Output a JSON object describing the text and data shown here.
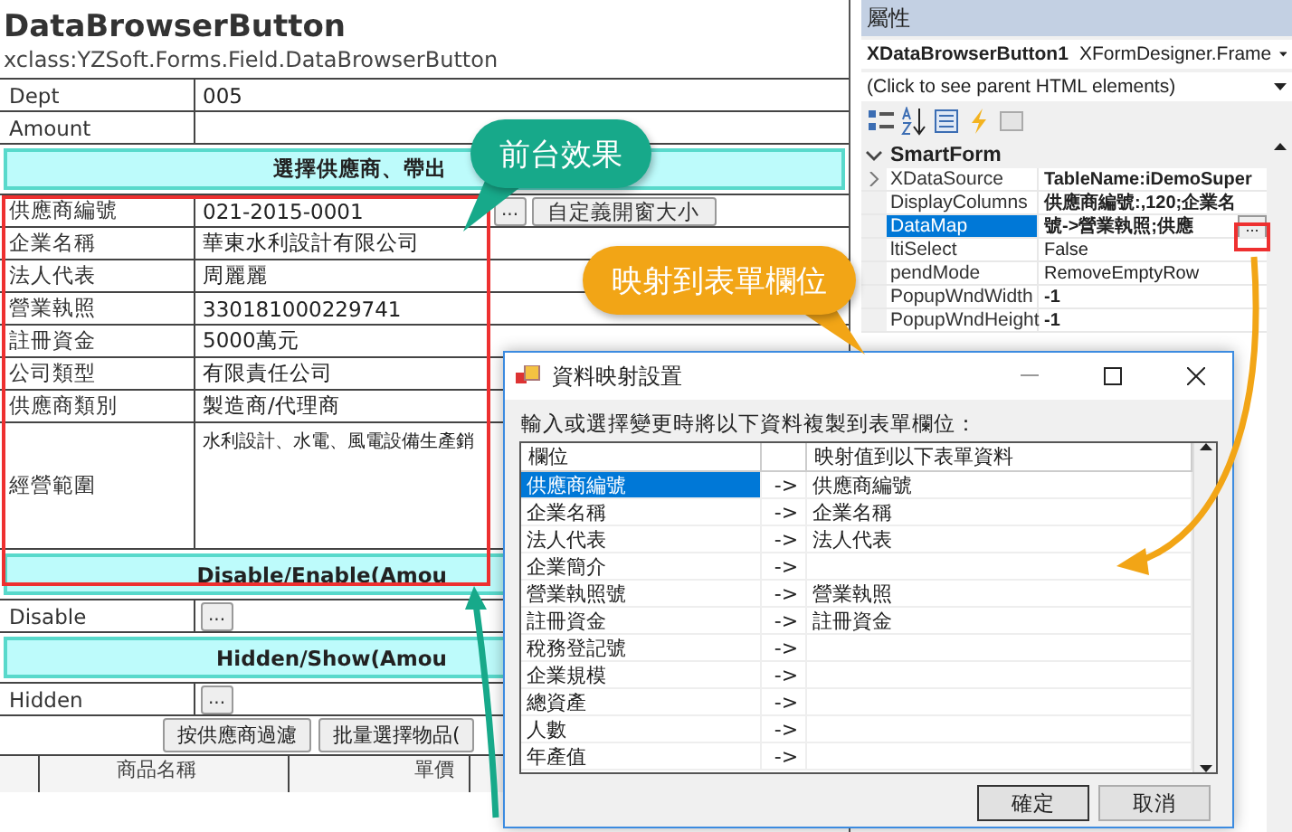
{
  "form": {
    "title": "DataBrowserButton",
    "subtitle": "xclass:YZSoft.Forms.Field.DataBrowserButton",
    "rows": [
      {
        "kind": "field",
        "label": "Dept",
        "value": "005"
      },
      {
        "kind": "field",
        "label": "Amount"
      },
      {
        "kind": "band",
        "text": "選擇供應商、帶出"
      },
      {
        "kind": "field",
        "label": "供應商編號",
        "value": "021-2015-0001",
        "buttons": [
          "...",
          "自定義開窗大小"
        ]
      },
      {
        "kind": "field",
        "label": "企業名稱",
        "value": "華東水利設計有限公司"
      },
      {
        "kind": "field",
        "label": "法人代表",
        "value": "周麗麗"
      },
      {
        "kind": "field",
        "label": "營業執照",
        "value": "330181000229741"
      },
      {
        "kind": "field",
        "label": "註冊資金",
        "value": "5000萬元"
      },
      {
        "kind": "field",
        "label": "公司類型",
        "value": "有限責任公司"
      },
      {
        "kind": "field",
        "label": "供應商類別",
        "value": "製造商/代理商"
      },
      {
        "kind": "area",
        "label": "經營範圍",
        "value": "水利設計、水電、風電設備生產銷"
      },
      {
        "kind": "band",
        "text": "Disable/Enable(Amou"
      },
      {
        "kind": "field",
        "label": "Disable",
        "buttons": [
          "..."
        ]
      },
      {
        "kind": "band",
        "text": "Hidden/Show(Amou"
      },
      {
        "kind": "field",
        "label": "Hidden",
        "buttons": [
          "..."
        ]
      },
      {
        "kind": "actions",
        "buttons": [
          "按供應商過濾",
          "批量選擇物品("
        ]
      },
      {
        "kind": "table_header",
        "columns": [
          "商品名稱",
          "單價"
        ]
      }
    ]
  },
  "properties": {
    "title": "屬性",
    "object": {
      "name": "XDataBrowserButton1",
      "type": "XFormDesigner.Frame"
    },
    "parent_hint": "(Click to see parent HTML elements)",
    "category": {
      "name": "SmartForm",
      "expanded": true
    },
    "rows": [
      {
        "name": "XDataSource",
        "value": "TableName:iDemoSuper",
        "expandable": true,
        "modified": true,
        "selected": false
      },
      {
        "name": "DisplayColumns",
        "value": "供應商編號:,120;企業名",
        "expandable": false,
        "modified": true,
        "selected": false
      },
      {
        "name": "DataMap",
        "value": "號->營業執照;供應",
        "expandable": false,
        "modified": true,
        "selected": true,
        "button": "..."
      },
      {
        "name": "ltiSelect",
        "value": "False",
        "expandable": false,
        "modified": false,
        "selected": false
      },
      {
        "name": "pendMode",
        "value": "RemoveEmptyRow",
        "expandable": false,
        "modified": false,
        "selected": false
      },
      {
        "name": "PopupWndWidth",
        "value": "-1",
        "expandable": false,
        "modified": true,
        "selected": false
      },
      {
        "name": "PopupWndHeight",
        "value": "-1",
        "expandable": false,
        "modified": true,
        "selected": false
      }
    ]
  },
  "dialog": {
    "title": "資料映射設置",
    "prompt": "輸入或選擇變更時將以下資料複製到表單欄位：",
    "columns": [
      "欄位",
      "映射值到以下表單資料"
    ],
    "rows": [
      {
        "field": "供應商編號",
        "arrow": "->",
        "target": "供應商編號",
        "selected": true
      },
      {
        "field": "企業名稱",
        "arrow": "->",
        "target": "企業名稱",
        "selected": false
      },
      {
        "field": "法人代表",
        "arrow": "->",
        "target": "法人代表",
        "selected": false
      },
      {
        "field": "企業簡介",
        "arrow": "->",
        "selected": false
      },
      {
        "field": "營業執照號",
        "arrow": "->",
        "target": "營業執照",
        "selected": false
      },
      {
        "field": "註冊資金",
        "arrow": "->",
        "target": "註冊資金",
        "selected": false
      },
      {
        "field": "稅務登記號",
        "arrow": "->",
        "selected": false
      },
      {
        "field": "企業規模",
        "arrow": "->",
        "selected": false
      },
      {
        "field": "總資產",
        "arrow": "->",
        "selected": false
      },
      {
        "field": "人數",
        "arrow": "->",
        "selected": false
      },
      {
        "field": "年產值",
        "arrow": "->",
        "selected": false
      }
    ],
    "buttons": [
      "確定",
      "取消"
    ]
  },
  "callouts": [
    {
      "text": "前台效果",
      "color": "#17a98a"
    },
    {
      "text": "映射到表單欄位",
      "color": "#f2a516"
    }
  ]
}
